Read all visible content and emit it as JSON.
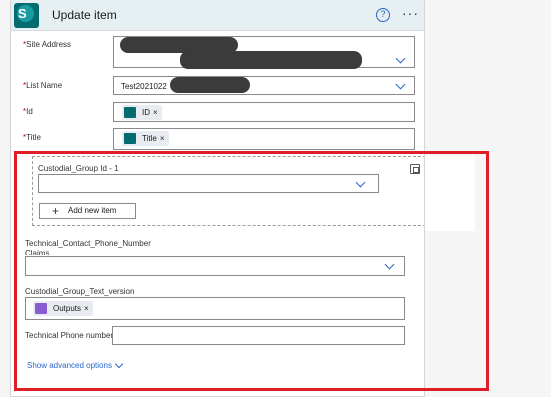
{
  "header": {
    "logo_letter": "S",
    "title": "Update item",
    "help_symbol": "?",
    "more_symbol": "···"
  },
  "fields": {
    "site_address": {
      "required": "*",
      "label": "Site Address"
    },
    "list_name": {
      "required": "*",
      "label": "List Name",
      "value": "Test2021022"
    },
    "id": {
      "required": "*",
      "label": "Id",
      "token": "ID"
    },
    "title": {
      "required": "*",
      "label": "Title",
      "token": "Title"
    },
    "custodial_group_id": {
      "label": "Custodial_Group Id - 1"
    },
    "technical_contact_phone": {
      "label": "Technical_Contact_Phone_Number"
    },
    "claims": {
      "label": "Claims"
    },
    "custodial_group_text": {
      "label": "Custodial_Group_Text_version",
      "token": "Outputs"
    },
    "technical_phone": {
      "label": "Technical Phone number"
    }
  },
  "token_close": "×",
  "buttons": {
    "add_new_item": "Add new item",
    "add_plus": "+"
  },
  "links": {
    "show_advanced": "Show advanced options"
  },
  "colors": {
    "accent": "#2b66c9",
    "sharepoint": "#036c70",
    "highlight_box": "#e01e27",
    "expression_token": "#8b5bd6"
  }
}
